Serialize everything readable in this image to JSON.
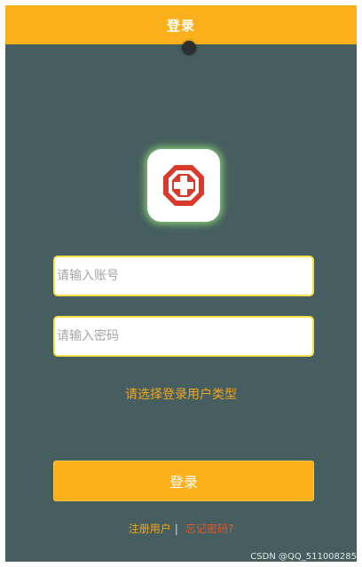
{
  "header": {
    "title": "登录"
  },
  "logo": {
    "icon": "medical-cross-icon",
    "color": "#d83a2c"
  },
  "form": {
    "account_placeholder": "请输入账号",
    "password_placeholder": "请输入密码",
    "user_type_prompt": "请选择登录用户类型",
    "login_label": "登录"
  },
  "links": {
    "register": "注册用户",
    "separator": "|",
    "forgot": "忘记密码?"
  },
  "watermark": "CSDN @QQ_511008285",
  "colors": {
    "accent": "#fbb01c",
    "background": "#465e5f",
    "link_orange": "#f0a522",
    "link_red": "#e25a2c"
  }
}
